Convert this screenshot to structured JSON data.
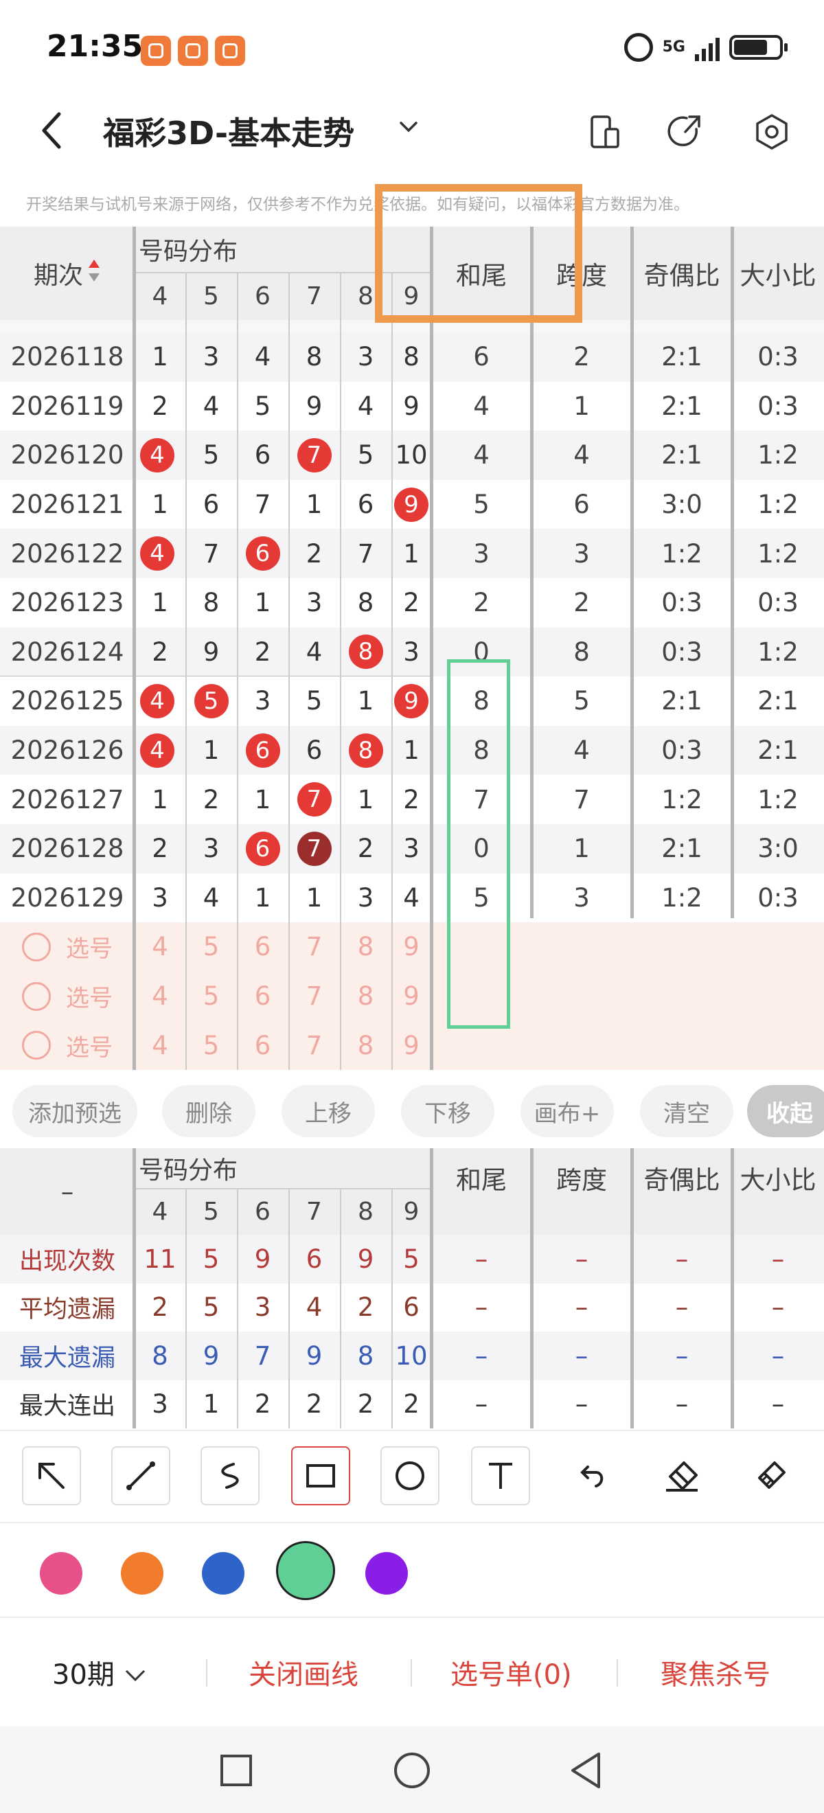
{
  "status": {
    "time": "21:35",
    "network": "5G"
  },
  "header": {
    "title": "福彩3D-基本走势"
  },
  "notice": "开奖结果与试机号来源于网络，仅供参考不作为兑奖依据。如有疑问，以福体彩官方数据为准。",
  "table": {
    "col_issue": "期次",
    "col_group": "号码分布",
    "digits": [
      "4",
      "5",
      "6",
      "7",
      "8",
      "9"
    ],
    "col_sum_tail": "和尾",
    "col_span": "跨度",
    "col_odd_even": "奇偶比",
    "col_big_small": "大小比",
    "rows": [
      {
        "issue": "2026118",
        "c": [
          "1",
          "3",
          "4",
          "8",
          "3",
          "8"
        ],
        "tail": "6",
        "span": "2",
        "oe": "2:1",
        "bs": "0:3"
      },
      {
        "issue": "2026119",
        "c": [
          "2",
          "4",
          "5",
          "9",
          "4",
          "9"
        ],
        "tail": "4",
        "span": "1",
        "oe": "2:1",
        "bs": "0:3"
      },
      {
        "issue": "2026120",
        "c": [
          "4",
          "5",
          "6",
          "7",
          "5",
          "10"
        ],
        "tail": "4",
        "span": "4",
        "oe": "2:1",
        "bs": "1:2"
      },
      {
        "issue": "2026121",
        "c": [
          "1",
          "6",
          "7",
          "1",
          "6",
          "9"
        ],
        "tail": "5",
        "span": "6",
        "oe": "3:0",
        "bs": "1:2"
      },
      {
        "issue": "2026122",
        "c": [
          "4",
          "7",
          "6",
          "2",
          "7",
          "1"
        ],
        "tail": "3",
        "span": "3",
        "oe": "1:2",
        "bs": "1:2"
      },
      {
        "issue": "2026123",
        "c": [
          "1",
          "8",
          "1",
          "3",
          "8",
          "2"
        ],
        "tail": "2",
        "span": "2",
        "oe": "0:3",
        "bs": "0:3"
      },
      {
        "issue": "2026124",
        "c": [
          "2",
          "9",
          "2",
          "4",
          "8",
          "3"
        ],
        "tail": "0",
        "span": "8",
        "oe": "0:3",
        "bs": "1:2"
      },
      {
        "issue": "2026125",
        "c": [
          "4",
          "5",
          "3",
          "5",
          "1",
          "9"
        ],
        "tail": "8",
        "span": "5",
        "oe": "2:1",
        "bs": "2:1"
      },
      {
        "issue": "2026126",
        "c": [
          "4",
          "1",
          "6",
          "6",
          "8",
          "1"
        ],
        "tail": "8",
        "span": "4",
        "oe": "0:3",
        "bs": "2:1"
      },
      {
        "issue": "2026127",
        "c": [
          "1",
          "2",
          "1",
          "7",
          "1",
          "2"
        ],
        "tail": "7",
        "span": "7",
        "oe": "1:2",
        "bs": "1:2"
      },
      {
        "issue": "2026128",
        "c": [
          "2",
          "3",
          "6",
          "7",
          "2",
          "3"
        ],
        "tail": "0",
        "span": "1",
        "oe": "2:1",
        "bs": "3:0"
      },
      {
        "issue": "2026129",
        "c": [
          "3",
          "4",
          "1",
          "1",
          "3",
          "4"
        ],
        "tail": "5",
        "span": "3",
        "oe": "1:2",
        "bs": "0:3"
      }
    ],
    "pick_label": "选号"
  },
  "actions": [
    "添加预选",
    "删除",
    "上移",
    "下移",
    "画布+",
    "清空",
    "收起"
  ],
  "stats": {
    "dash": "–",
    "rows": [
      {
        "label": "出现次数",
        "c": [
          "11",
          "5",
          "9",
          "6",
          "9",
          "5"
        ],
        "color": "#b43a3a"
      },
      {
        "label": "平均遗漏",
        "c": [
          "2",
          "5",
          "3",
          "4",
          "2",
          "6"
        ],
        "color": "#8a3a2a"
      },
      {
        "label": "最大遗漏",
        "c": [
          "8",
          "9",
          "7",
          "9",
          "8",
          "10"
        ],
        "color": "#3a5bb4"
      },
      {
        "label": "最大连出",
        "c": [
          "3",
          "1",
          "2",
          "2",
          "2",
          "2"
        ],
        "color": "#333333"
      }
    ]
  },
  "palette": [
    "#e8508a",
    "#f07c2c",
    "#2e63c9",
    "#5fcf95",
    "#8a1ee6"
  ],
  "bottom": {
    "period": "30期",
    "close_draw": "关闭画线",
    "pick_list": "选号单(0)",
    "focus_kill": "聚焦杀号"
  }
}
